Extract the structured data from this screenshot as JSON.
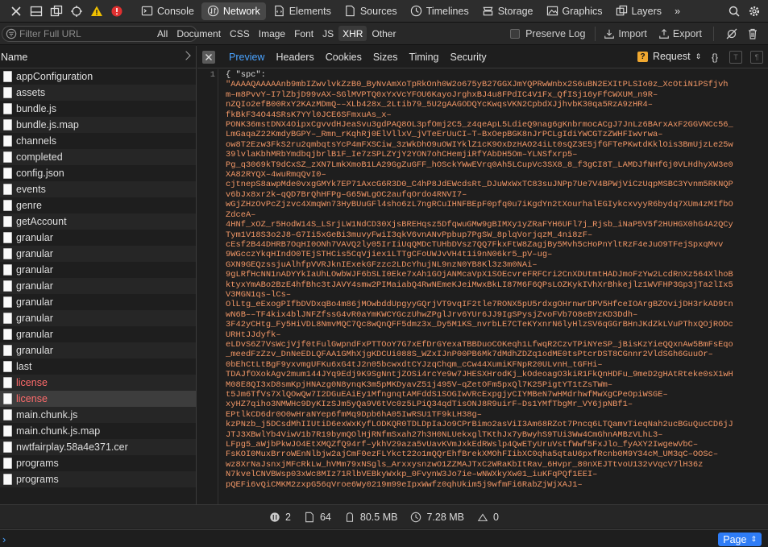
{
  "toolbar": {
    "tabs": [
      {
        "label": "Console",
        "icon": "console-icon"
      },
      {
        "label": "Network",
        "icon": "network-icon",
        "active": true
      },
      {
        "label": "Elements",
        "icon": "elements-icon"
      },
      {
        "label": "Sources",
        "icon": "sources-icon"
      },
      {
        "label": "Timelines",
        "icon": "timelines-icon"
      },
      {
        "label": "Storage",
        "icon": "storage-icon"
      },
      {
        "label": "Graphics",
        "icon": "graphics-icon"
      },
      {
        "label": "Layers",
        "icon": "layers-icon"
      }
    ],
    "more": "»",
    "colors": {
      "warning": "#f0c000",
      "error": "#e03030",
      "accent": "#4aa3ff"
    }
  },
  "filter": {
    "placeholder": "Filter Full URL",
    "types": [
      "All",
      "Document",
      "CSS",
      "Image",
      "Font",
      "JS",
      "XHR",
      "Other"
    ],
    "active_type": "XHR",
    "preserve_log": "Preserve Log",
    "import": "Import",
    "export": "Export"
  },
  "list": {
    "header": "Name",
    "items": [
      "appConfiguration",
      "assets",
      "bundle.js",
      "bundle.js.map",
      "channels",
      "completed",
      "config.json",
      "events",
      "genre",
      "getAccount",
      "granular",
      "granular",
      "granular",
      "granular",
      "granular",
      "granular",
      "granular",
      "granular",
      "last",
      "license",
      "license",
      "main.chunk.js",
      "main.chunk.js.map",
      "nwtfairplay.58a4e371.cer",
      "programs",
      "programs"
    ]
  },
  "detail": {
    "tabs": [
      "Preview",
      "Headers",
      "Cookies",
      "Sizes",
      "Timing",
      "Security"
    ],
    "active_tab": "Preview",
    "request_label": "Request",
    "close": "×",
    "line_number": "1",
    "lines": [
      "{ \"spc\":",
      "\"AAAAQAAAAAnb9mbIZwvlvkZzB0_ByNvAmXoTpRkOnh0W2o675yB27GGXJmYQPRwWnbx2S6uBN2EXItPLSIo0z_XcOtiN1PSfjvh",
      "m–m8PvvY–I7lZbjD99vAX–SGlMVPTQ0xYxVcYFOU6KayoJrghxBJ4u8FPdIC4V1Fx_QfISj16yFfCWXUM_n9R–",
      "nZQIo2efB00RxY2KAzMDmQ––XLb428x_2Ltib79_5U2gAAGODQYcKwqsVKN2CpbdXJjhvbK30qa5RzA9zHR4–",
      "fkBkF34O44SRsK7YYl0JCE6SFmxuAs_x–",
      "PONK36mstDNX4OipxCgvvdHJeaSvu3gdPAQ8OL3pfOmj2C5_z4qeApL5LdieQ9nag6gKnbrmocACgJ7JnLz6BArxAxF2GGVNCc56_",
      "LmGaqaZ22KmdyBGPY–_Rmn_rKqhRj0ElVllxV_jVTeErUuCI–T–BxOepBGK8nJrPCLgIdiYWCGTzZWHFIwvrwa–",
      "ow8T2Ezw3FkS2ru2qmbqtsYcP4mFXSCiw_3zWkDhO9uOWIYklZ1cK9OxDzHAO24iLt0sQZ3E5jfGFTePKwtdKklOis3BmUjzLe25w",
      "39lvlaKbhMRbYmdbqjbrlB1F_Ie7zSPLZYjY2YON7ohCHemjiRfYAbDH5Om–YLNSfxrp5–",
      "Pg_q3069kT9dCxSZ_zXN7LmkXmoB1LA29GgZuGFF_hOSckYWwEVrq0Ah5LCupVc3SX8_8_f3gCI8T_LAMDJfNHfGj0VLHdhyXW3e0",
      "XA82RYQX–4wuRmqQvI0–",
      "cjtnepS8awpMde0vxgGMYk7EP71AxcG6R3D0_C4hP8JdEWcdsRt_DJuWxWxTC83suJNPp7Ue7V4BPWjViCzUqpMSBC3Yvnm5RKNQP",
      "v6bJx8xr2k–qQD7BrQhHFPg–G65WLgOC2aufqOrdo4RNVI7–",
      "wGjZHzOvPcZjzvc4XmqWn73HyBUuGFl4sho6zL7ngRCuIHNFBEpF0pfq0u7iKgdYn2tXourhalEGIykcxvyyR6bydq7XUm4zMIfbO",
      "ZdceA–",
      "4HNf_xOZ_r5HodW14S_LSrjLW1NdCD30XjsBREHqsz5DfqwuGMw9gBIMXy1yZRaFYH6UFl7j_Rjsb_iNaP5V5f2HUHGX0hG4A2QCy",
      "Tym1V18S3o2J8–G7Ii5xGeBi3muvyFwiI3qkV6vnANvPpbup7PgSW_8plqVorjqzM_4ni8zF–",
      "cEsf2B44DHRB7OqHI0ONh7VAVQ2ly05IrIiUqQMDcTUHbDVsz7QQ7FkxFtW8ZagjBy5Mvh5cHoPnYltRzF4eJuO9TFejSpxqMvv",
      "9WGcczYkqHIndO0TEjSTHCis5CqVjiex1LTTgCFoUWJvVH4t1i9nN06kr5_pV–ug–",
      "GXN9GEQzssjuAlhfpVVRJknIExekGFzzc2LDcYhujNL9nzN0YB8Kl3z3m0NAi–",
      "9gLRfHcNN1nADYYkIaUhLOwbWJF6bSLI0Eke7xAh1GOjANMcaVpX1SOEcvreFRFCri2CnXDUtmtHADJmoFzYw2LcdRnXz564XlhoB",
      "ktyxYmABo2BzE4hfBhc3tJAVY4smw2PIMaiabQ4RwNEmeKJeiMwxBkLI87M6F6QPsLOZKykIVhXrBhkejlz1WVFHP3Gp3jTa2lIx5",
      "V3MGN1qs–lCs–",
      "OlLtg_eExogPIfbDVDxqBo4m86jMOwbddUpgyyGQrjVT9vqIF2tle7RONX5pU5rdxgOHrnwrDPV5HfceIOArgBZOvijDH3rkAD9tn",
      "wN6B––TF4kix4blJNFZfssG4vR0aYmKWCYGczUhwZPglJrv6YUr6JJ9IgSPysjZvoFVb7O8eBYzKD3Ddh–",
      "3F42yCHtg_Fy5HiVDL8NmvMQC7Qc8wQnQFF5dmz3x_Dy5M1KS_nvrbLE7CTeKYxnrN6lyHlzSV6qGGrBHnJKdZkLVuPThxQOjRODc",
      "URHtJJdyfk–",
      "eLDvS6Z7VsWcjVjf0tFulGwpndFxPTTOoY7G7xEfDrGYexaTBBDuoCOKeqh1LfwqR2CzvTPiNYeSP_jBisKzYieQQxnAw5BmFsEqo",
      "_meedFzZzv_DnNeEDLQFAA1GMhXjgKDCUi088S_WZxIJnP00PB6Mk7dMdhZDZq1odME0tsPtcrDST8CGnnr2VldSGh6GuuOr–",
      "0bEhCtLtBgF9yxvmgUFKu6xG4tJ2n05bcwxdtCYJzqChqm_cCw44XumiKFNpR20ULvnH_tGFHi–",
      "TDAJfOXokAgv2mum144JYq9Edj9K9SgNntjZOSi4rcYe9w7JHESXHrodKj_kOdeoagO3kiR1FkQnHDFu_9meD2gHAtRteke0sX1wH",
      "M08E8QI3xD8smKpjHNAzg0N8ynqK3m5pMKDyavZ51j495V–qZetOFm5pxQl7K25PigtYT1tZsTWm–",
      "t5Jm6TfVs7XlQOwQw7I2DGuEAiEy1MfngnqtAMFddS1SOGIwVRcExpgjyCIYMBeN7wHMdrhwfMwXgCPeOpiWSGE–",
      "xyHZ7qiho3NMWHc9DyKIzSJm5yQa9V6tVc0z5LPiQ34qdTisONJ8R9uirF–Ds1YMfTbgMr_VY6jpNBf1–",
      "EPtlkCD6dr0O0wHraNYep6fmMq9Dpb6hA05IwRSU1TF9kLH38g–",
      "kzPNzb_j5DCsdMhIIUtiD6exWxKyfLODKQR0TDLDpIaJo9CPrBimo2asViI3Am68RZot7Pncq6LTQamvTieqNah2ucBGuQucCD6jJ",
      "JTJ3XBwlYb4ViwV1b7R19bymQOlHjRNfmSxah27h3H0NLUekxglTKthJx7yBwyhS9TUi3Ww4CmGhnAMBzVLhL3–",
      "LFpg5_aWjbPkwJO4EtXMQZfQ94rf–ykhV29aza5vUavKVmJxkEdRWslp4QwETyUruVstfWwf5FxJlo_fyAXY2IwgewVbC–",
      "FsKOI0MuxBrroWEnNlbjw2ajCmF0ezFLYkct22o1mQQrEhfBrekXMOhFIibXC0qha5qtaU6pxfRcnb0M9Y34cM_UM3qC–OOSc–",
      "wz8XrNaJsnxjMFcRkLw_hVMm79xNSgls_ArxxysnzwO1ZZMAJTxC2WRaKbItRav_6Hvpr_80nXEJTtvoU132vVqcV7lH36z",
      "N7kvelCNVBWsp03xWc8MIz71RlbVEBkyWxkp_0FvynW3Jo7ie–wNWXkyXw01_iuKFqPQf1EEI–",
      "pQEFi6vQiCMKM2zxpG56qVroe6Wy0219m99eIpxWwfz0qhUkim5j9wfmFi6RabZjWjXAJ1–"
    ]
  },
  "stats": [
    {
      "icon": "requests-icon",
      "value": "2"
    },
    {
      "icon": "resources-icon",
      "value": "64"
    },
    {
      "icon": "transferred-icon",
      "value": "80.5 MB"
    },
    {
      "icon": "time-icon",
      "value": "7.28 MB"
    },
    {
      "icon": "load-icon",
      "value": "0"
    }
  ],
  "console": {
    "prompt": "›",
    "page_button": "Page"
  }
}
